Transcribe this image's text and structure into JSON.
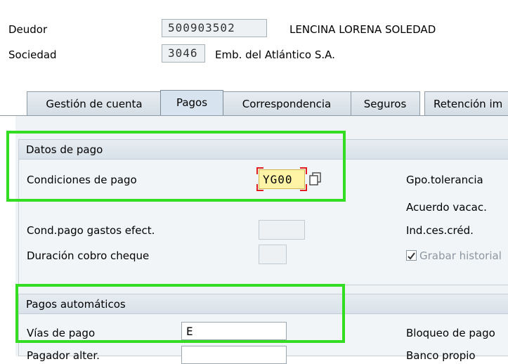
{
  "header": {
    "deudor_label": "Deudor",
    "deudor_value": "500903502",
    "deudor_name": "LENCINA LORENA SOLEDAD",
    "sociedad_label": "Sociedad",
    "sociedad_value": "3046",
    "sociedad_name": "Emb. del Atlántico S.A."
  },
  "tabs": [
    {
      "label": "Gestión de cuenta"
    },
    {
      "label": "Pagos",
      "active": true
    },
    {
      "label": "Correspondencia"
    },
    {
      "label": "Seguros"
    },
    {
      "label": "Retención im"
    }
  ],
  "datos_pago": {
    "title": "Datos de pago",
    "condiciones_label": "Condiciones de pago",
    "condiciones_value": "YG00",
    "cond_gastos_label": "Cond.pago gastos efect.",
    "duracion_label": "Duración cobro cheque",
    "gpo_tolerancia_label": "Gpo.tolerancia",
    "acuerdo_vacac_label": "Acuerdo vacac.",
    "ind_ces_label": "Ind.ces.créd.",
    "grabar_historial_label": "Grabar historial",
    "grabar_historial_checked": true
  },
  "pagos_automaticos": {
    "title": "Pagos automáticos",
    "vias_label": "Vías de pago",
    "vias_value": "E",
    "bloqueo_label": "Bloqueo de pago",
    "pagador_label": "Pagador alter.",
    "banco_label": "Banco propio"
  },
  "colors": {
    "highlight": "#33dd22",
    "required_field": "#fff3a6",
    "required_marker": "#e02020"
  }
}
